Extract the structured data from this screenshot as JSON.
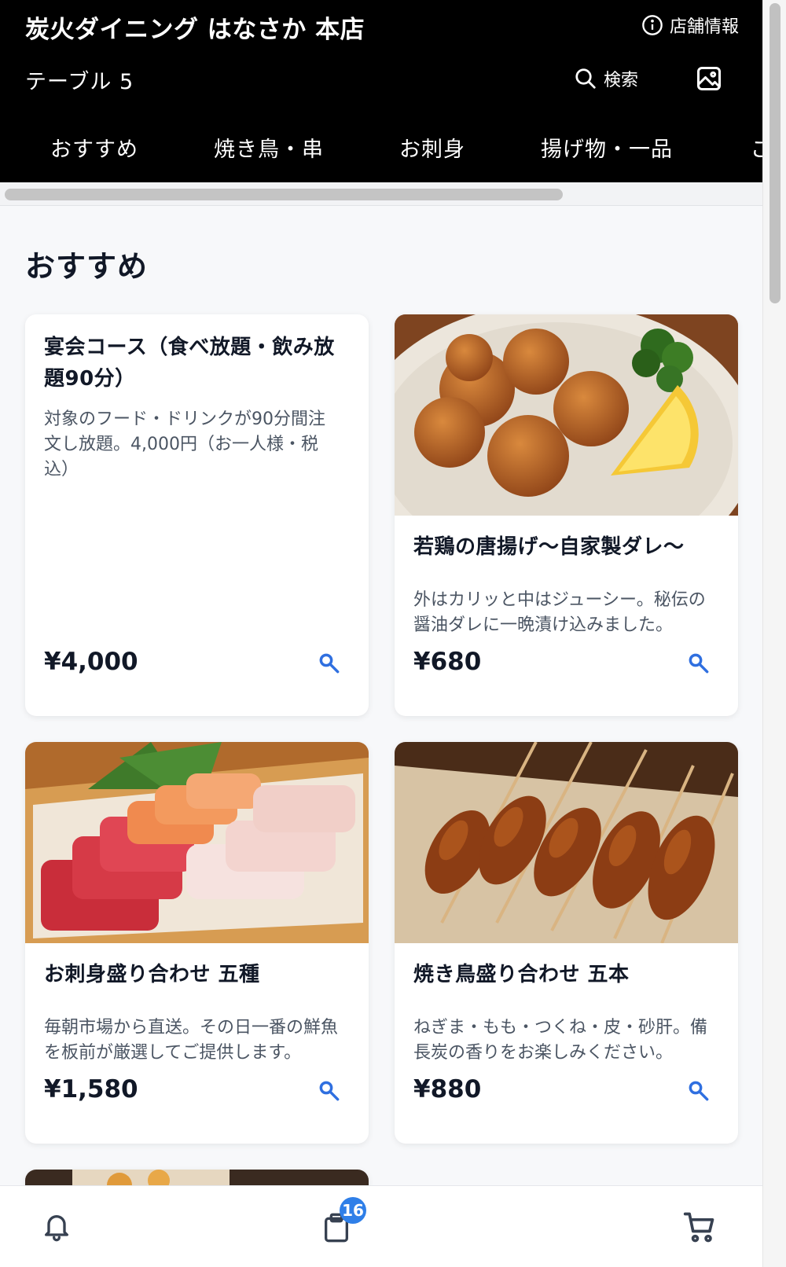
{
  "header": {
    "store_name": "炭火ダイニング はなさか 本店",
    "info_label": "店舗情報",
    "table_label": "テーブル 5",
    "search_label": "検索"
  },
  "tabs": [
    {
      "label": "おすすめ"
    },
    {
      "label": "焼き鳥・串"
    },
    {
      "label": "お刺身"
    },
    {
      "label": "揚げ物・一品"
    },
    {
      "label": "ご"
    }
  ],
  "section": {
    "title": "おすすめ"
  },
  "menu_items": [
    {
      "name": "宴会コース（食べ放題・飲み放題90分）",
      "description": "対象のフード・ドリンクが90分間注文し放題。4,000円（お一人様・税込）",
      "price": "¥4,000",
      "has_photo": false
    },
    {
      "name": "若鶏の唐揚げ〜自家製ダレ〜",
      "description": "外はカリッと中はジューシー。秘伝の醤油ダレに一晩漬け込みました。",
      "price": "¥680",
      "has_photo": true,
      "photo": "fried-chicken"
    },
    {
      "name": "お刺身盛り合わせ 五種",
      "description": "毎朝市場から直送。その日一番の鮮魚を板前が厳選してご提供します。",
      "price": "¥1,580",
      "has_photo": true,
      "photo": "sashimi"
    },
    {
      "name": "焼き鳥盛り合わせ 五本",
      "description": "ねぎま・もも・つくね・皮・砂肝。備長炭の香りをお楽しみください。",
      "price": "¥880",
      "has_photo": true,
      "photo": "yakitori"
    }
  ],
  "bottom_nav": {
    "order_count_badge": "16"
  },
  "colors": {
    "header_bg": "#000000",
    "accent": "#2f7fe8",
    "page_bg": "#f7f8fa"
  }
}
